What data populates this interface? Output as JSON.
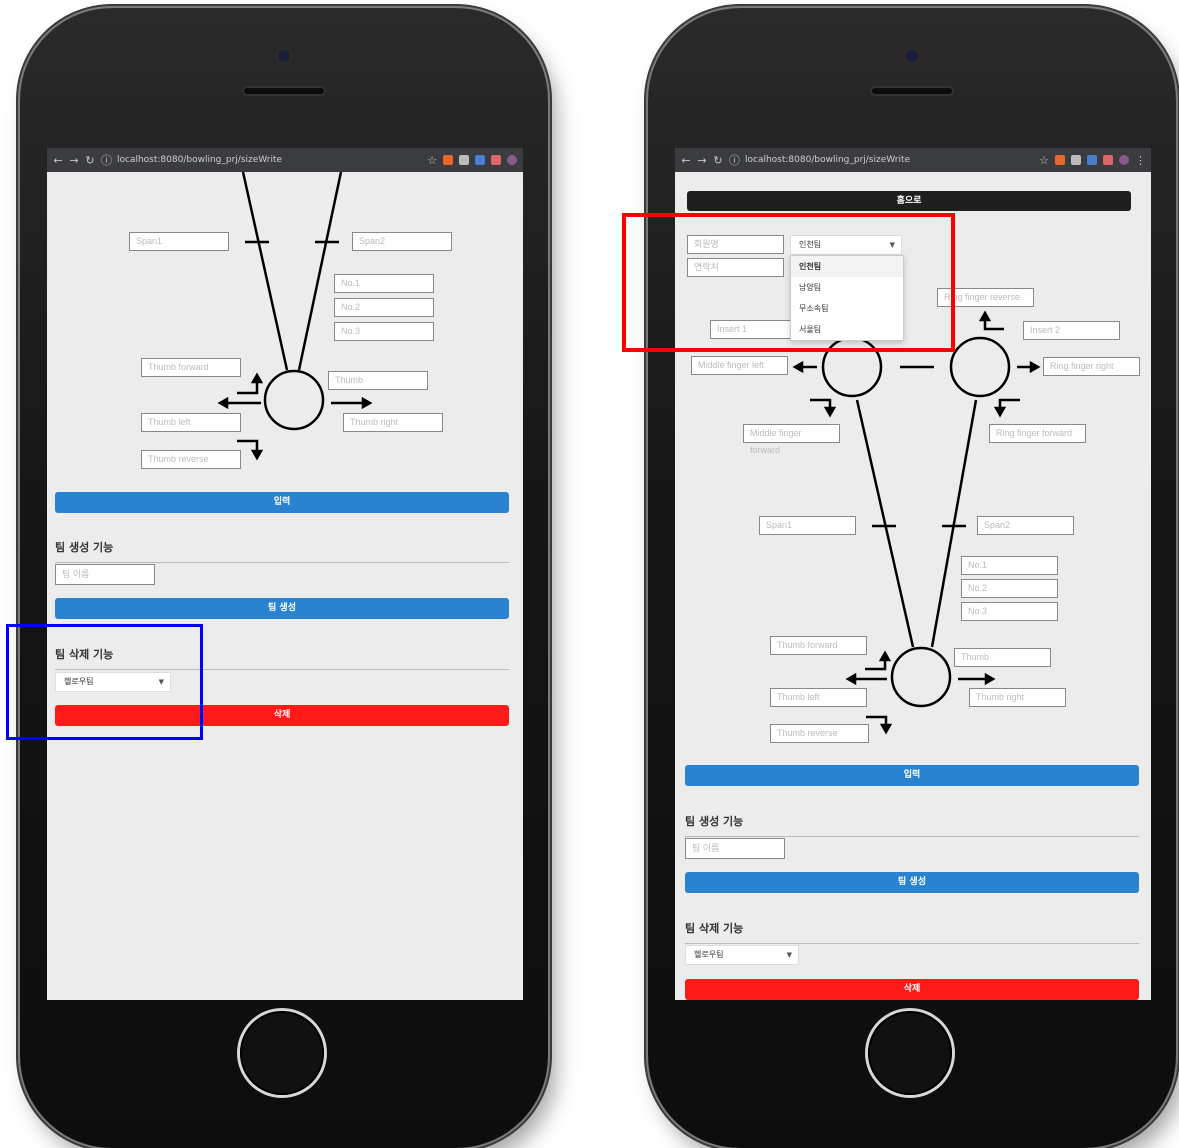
{
  "browser": {
    "url": "localhost:8080/bowling_prj/sizeWrite"
  },
  "left": {
    "fields": {
      "span1": "Span1",
      "span2": "Span2",
      "no1": "No.1",
      "no2": "No.2",
      "no3": "No.3",
      "thumb_forward": "Thumb forward",
      "thumb": "Thumb",
      "thumb_left": "Thumb left",
      "thumb_right": "Thumb right",
      "thumb_reverse": "Thumb reverse"
    },
    "input_button": "입력",
    "team_create": {
      "title": "팀 생성 기능",
      "placeholder": "팀 이름",
      "button": "팀 생성"
    },
    "team_delete": {
      "title": "팀 삭제 기능",
      "selected": "헬로우팀",
      "button": "삭제"
    }
  },
  "right": {
    "home_button": "홈으로",
    "member_name": "회원명",
    "contact": "연락처",
    "team_select": {
      "selected": "인천팀",
      "options": [
        "인천팀",
        "남양팀",
        "무소속팀",
        "서울팀"
      ]
    },
    "fields": {
      "insert1": "Insert 1",
      "insert2": "Insert 2",
      "ring_finger_reverse": "Ring finger reverse",
      "middle_finger_left": "Middle finger left",
      "ring_finger_right": "Ring finger right",
      "middle_finger_forward": "Middle finger forward",
      "ring_finger_forward": "Ring finger forward",
      "span1": "Span1",
      "span2": "Span2",
      "no1": "No.1",
      "no2": "No.2",
      "no3": "No.3",
      "thumb_forward": "Thumb forward",
      "thumb": "Thumb",
      "thumb_left": "Thumb left",
      "thumb_right": "Thumb right",
      "thumb_reverse": "Thumb reverse"
    },
    "input_button": "입력",
    "team_create": {
      "title": "팀 생성 기능",
      "placeholder": "팀 이름",
      "button": "팀 생성"
    },
    "team_delete": {
      "title": "팀 삭제 기능",
      "selected": "헬로우팀",
      "button": "삭제"
    }
  },
  "colors": {
    "highlight_red": "#ff0000",
    "highlight_blue": "#0000ff",
    "btn_blue": "#2a83d1",
    "btn_red": "#ff1a1a"
  }
}
